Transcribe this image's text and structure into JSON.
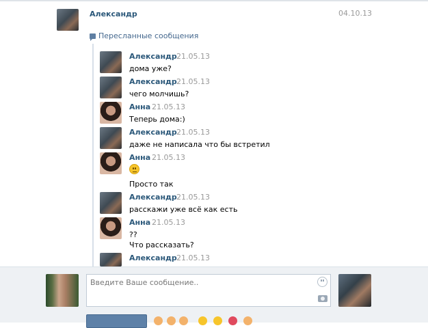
{
  "header": {
    "sender": "Александр",
    "date": "04.10.13",
    "forwarded_label": "Пересланные сообщения"
  },
  "messages": [
    {
      "author": "Александр",
      "time": "21.05.13",
      "text": "дома уже?",
      "avatar": "male-avatar"
    },
    {
      "author": "Александр",
      "time": "21.05.13",
      "text": "чего молчишь?",
      "avatar": "male-avatar"
    },
    {
      "author": "Анна",
      "time": "21.05.13",
      "text": "Теперь дома:)",
      "avatar": "female-avatar"
    },
    {
      "author": "Александр",
      "time": "21.05.13",
      "text": "даже не написала что бы встретил",
      "avatar": "male-avatar"
    },
    {
      "author": "Анна",
      "time": "21.05.13",
      "text": "Просто так",
      "emoji": "neutral-face-emoji",
      "avatar": "female-avatar"
    },
    {
      "author": "Александр",
      "time": "21.05.13",
      "text": "расскажи уже всё как есть",
      "avatar": "male-avatar"
    },
    {
      "author": "Анна",
      "time": "21.05.13",
      "text": "??",
      "text2": "Что рассказать?",
      "avatar": "female-avatar"
    },
    {
      "author": "Александр",
      "time": "21.05.13",
      "text": "",
      "avatar": "male-avatar"
    }
  ],
  "composer": {
    "placeholder": "Введите Ваше сообщение..",
    "send_label": "",
    "icons": [
      "smile-icon",
      "camera-icon"
    ]
  },
  "colors": {
    "link": "#2b587a",
    "muted": "#999999",
    "bar": "#eef1f4",
    "button": "#5e81a8"
  }
}
